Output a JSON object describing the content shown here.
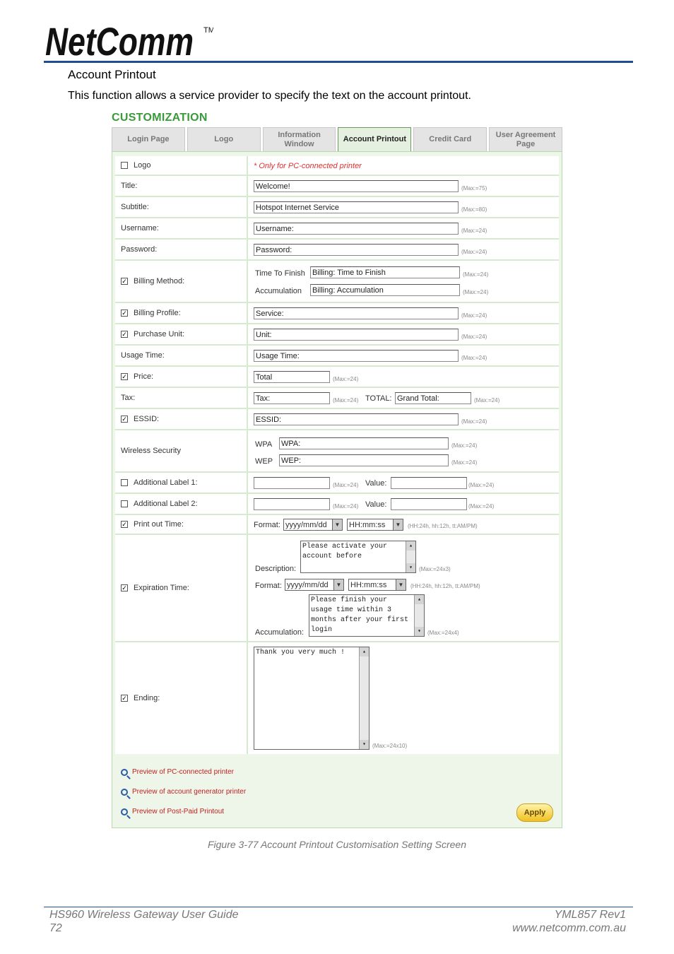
{
  "header": {
    "brand": "NetComm",
    "tm": "TM"
  },
  "section": {
    "title": "Account Printout",
    "intro": "This function allows a service provider to specify the text on the account printout."
  },
  "customization": {
    "heading": "CUSTOMIZATION",
    "tabs": [
      {
        "label": "Login Page",
        "active": false
      },
      {
        "label": "Logo",
        "active": false
      },
      {
        "label": "Information Window",
        "active": false
      },
      {
        "label": "Account Printout",
        "active": true
      },
      {
        "label": "Credit Card",
        "active": false
      },
      {
        "label": "User Agreement Page",
        "active": false
      }
    ],
    "logo": {
      "label": "Logo",
      "checked": false,
      "note": "* Only for PC-connected printer"
    },
    "title": {
      "label": "Title:",
      "value": "Welcome!",
      "max": "(Max:=75)"
    },
    "subtitle": {
      "label": "Subtitle:",
      "value": "Hotspot Internet Service",
      "max": "(Max:=80)"
    },
    "username": {
      "label": "Username:",
      "value": "Username:",
      "max": "(Max:=24)"
    },
    "password": {
      "label": "Password:",
      "value": "Password:",
      "max": "(Max:=24)"
    },
    "billing_method": {
      "label": "Billing Method:",
      "checked": true,
      "ttf_label": "Time To Finish",
      "ttf_value": "Billing: Time to Finish",
      "ttf_max": "(Max:=24)",
      "acc_label": "Accumulation",
      "acc_value": "Billing: Accumulation",
      "acc_max": "(Max:=24)"
    },
    "billing_profile": {
      "label": "Billing Profile:",
      "checked": true,
      "value": "Service:",
      "max": "(Max:=24)"
    },
    "purchase_unit": {
      "label": "Purchase Unit:",
      "checked": true,
      "value": "Unit:",
      "max": "(Max:=24)"
    },
    "usage_time": {
      "label": "Usage Time:",
      "value": "Usage Time:",
      "max": "(Max:=24)"
    },
    "price": {
      "label": "Price:",
      "checked": true,
      "value": "Total",
      "max": "(Max:=24)"
    },
    "tax": {
      "label": "Tax:",
      "value": "Tax:",
      "max": "(Max:=24)",
      "total_label": "TOTAL:",
      "total_value": "Grand Total:",
      "total_max": "(Max:=24)"
    },
    "essid": {
      "label": "ESSID:",
      "checked": true,
      "value": "ESSID:",
      "max": "(Max:=24)"
    },
    "wireless": {
      "label": "Wireless Security",
      "wpa_label": "WPA",
      "wpa_value": "WPA:",
      "wpa_max": "(Max:=24)",
      "wep_label": "WEP",
      "wep_value": "WEP:",
      "wep_max": "(Max:=24)"
    },
    "add1": {
      "label": "Additional Label 1:",
      "checked": false,
      "value": "",
      "max": "(Max:=24)",
      "value_label": "Value:",
      "value2": "",
      "max2": "(Max:=24)"
    },
    "add2": {
      "label": "Additional Label 2:",
      "checked": false,
      "value": "",
      "max": "(Max:=24)",
      "value_label": "Value:",
      "value2": "",
      "max2": "(Max:=24)"
    },
    "print_time": {
      "label": "Print out Time:",
      "checked": true,
      "format_label": "Format:",
      "date_fmt": "yyyy/mm/dd",
      "time_fmt": "HH:mm:ss",
      "hint": "(HH:24h, hh:12h, tt:AM/PM)"
    },
    "expiration": {
      "label": "Expiration Time:",
      "checked": true,
      "desc_label": "Description:",
      "desc_value": "Please activate your\naccount before",
      "desc_max": "(Max:=24x3)",
      "format_label": "Format:",
      "date_fmt": "yyyy/mm/dd",
      "time_fmt": "HH:mm:ss",
      "hint": "(HH:24h, hh:12h, tt:AM/PM)",
      "acc_label": "Accumulation:",
      "acc_value": "Please finish your\nusage time within 3\nmonths after your first\nlogin",
      "acc_max": "(Max:=24x4)"
    },
    "ending": {
      "label": "Ending:",
      "checked": true,
      "value": "Thank you very much !",
      "max": "(Max:=24x10)"
    },
    "links": [
      "Preview of PC-connected printer",
      "Preview of account generator printer",
      "Preview of Post-Paid Printout"
    ],
    "apply": "Apply"
  },
  "caption": "Figure 3-77 Account Printout Customisation Setting Screen",
  "footer": {
    "guide": "HS960 Wireless Gateway User Guide",
    "page": "72",
    "rev": "YML857 Rev1",
    "url": "www.netcomm.com.au"
  },
  "colors": {
    "rule": "#1f4e8c",
    "heading": "#3a9a3a",
    "link": "#c02020"
  }
}
